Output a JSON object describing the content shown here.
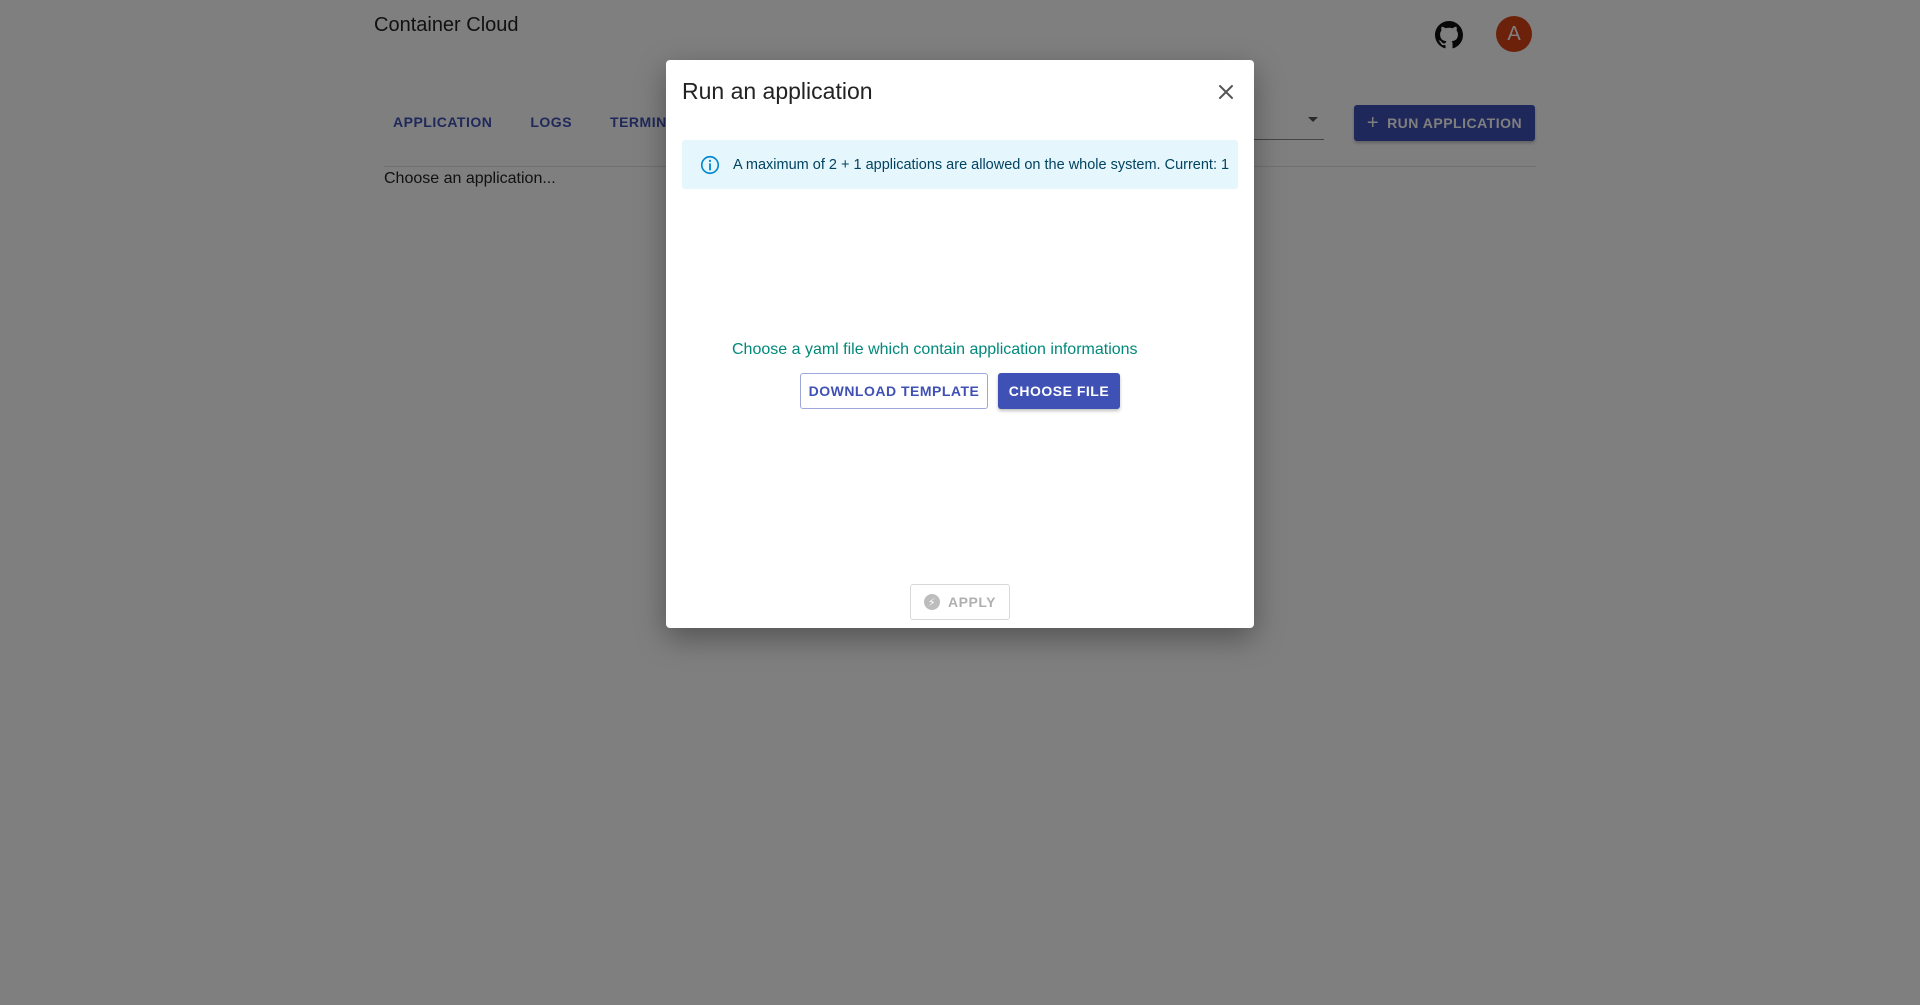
{
  "header": {
    "title": "Container Cloud",
    "avatar_initial": "A",
    "github_icon": "github-icon"
  },
  "tabs": [
    {
      "label": "APPLICATION"
    },
    {
      "label": "LOGS"
    },
    {
      "label": "TERMINAL"
    }
  ],
  "toolbar": {
    "run_label": "RUN APPLICATION",
    "run_icon": "plus-icon"
  },
  "main": {
    "placeholder": "Choose an application..."
  },
  "modal": {
    "title": "Run an application",
    "info": "A maximum of 2 + 1 applications are allowed on the whole system. Current: 1",
    "prompt": "Choose a yaml file which contain application informations",
    "download_label": "DOWNLOAD TEMPLATE",
    "choose_label": "CHOOSE FILE",
    "apply_label": "APPLY"
  },
  "colors": {
    "primary": "#3f51b5",
    "avatar": "#d84315",
    "info_bg": "#e5f6fd",
    "prompt_text": "#00897b"
  }
}
